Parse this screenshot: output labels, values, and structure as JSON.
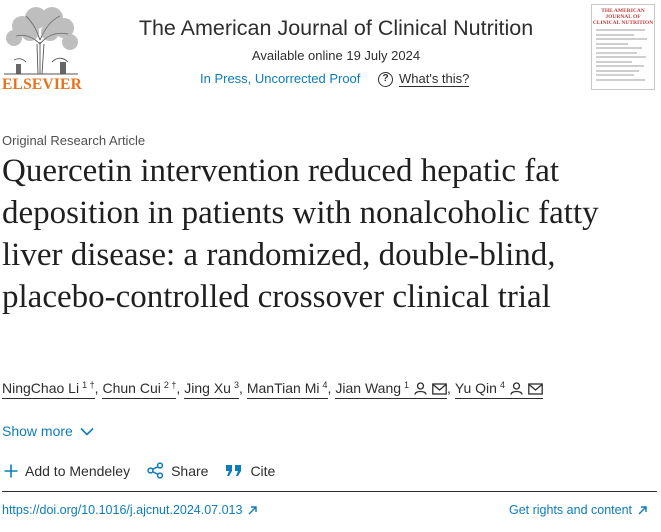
{
  "header": {
    "publisher": "ELSEVIER",
    "journal_title": "The American Journal of Clinical Nutrition",
    "available_online": "Available online 19 July 2024",
    "status_link": "In Press, Uncorrected Proof",
    "whats_this": "What's this?",
    "cover_title": "THE AMERICAN JOURNAL OF CLINICAL NUTRITION"
  },
  "article": {
    "type": "Original Research Article",
    "title": "Quercetin intervention reduced hepatic fat deposition in patients with nonalcoholic fatty liver disease: a randomized, double-blind, placebo-controlled crossover clinical trial",
    "authors": [
      {
        "name": "NingChao Li",
        "sup": "1 †"
      },
      {
        "name": "Chun Cui",
        "sup": "2 †"
      },
      {
        "name": "Jing Xu",
        "sup": "3"
      },
      {
        "name": "ManTian Mi",
        "sup": "4"
      },
      {
        "name": "Jian Wang",
        "sup": "1"
      },
      {
        "name": "Yu Qin",
        "sup": "4"
      }
    ],
    "show_more": "Show more"
  },
  "actions": {
    "mendeley": "Add to Mendeley",
    "share": "Share",
    "cite": "Cite"
  },
  "footer": {
    "doi": "https://doi.org/10.1016/j.ajcnut.2024.07.013",
    "rights": "Get rights and content"
  },
  "colors": {
    "link": "#0c7dbb",
    "publisher_orange": "#e9711c",
    "text": "#2e2e2e"
  }
}
